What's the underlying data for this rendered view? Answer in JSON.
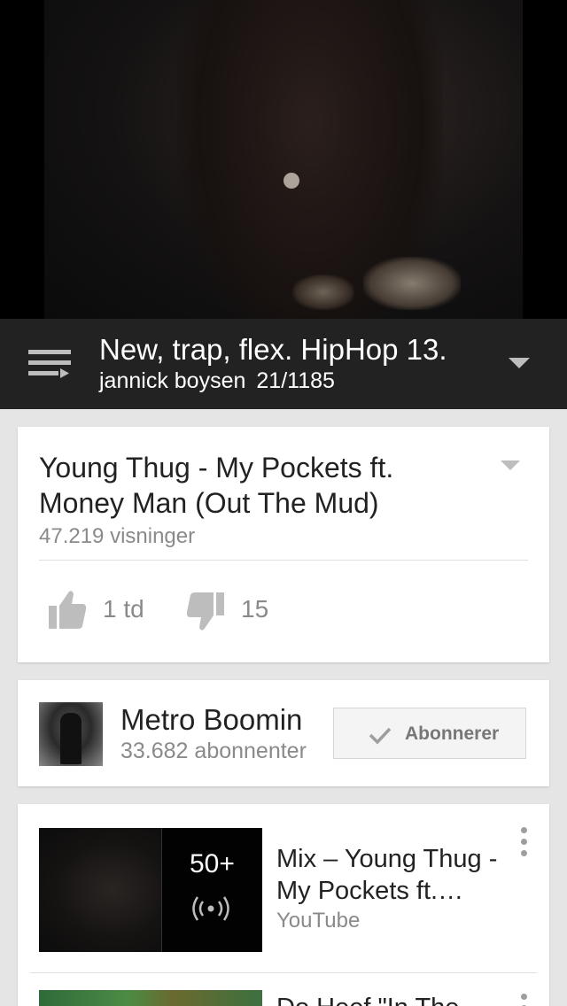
{
  "playlist": {
    "title": "New, trap, flex. HipHop 13.",
    "owner": "jannick boysen",
    "position": "21/1185"
  },
  "video": {
    "title": "Young Thug - My Pockets ft. Money Man (Out The Mud)",
    "views": "47.219 visninger",
    "likes": "1 td",
    "dislikes": "15"
  },
  "channel": {
    "name": "Metro Boomin",
    "subscribers": "33.682 abonnenter",
    "subscribe_label": "Abonnerer"
  },
  "up_next": [
    {
      "title": "Mix – Young Thug - My Pockets ft.…",
      "source": "YouTube",
      "count": "50+"
    },
    {
      "title": "Do Heef \"In The"
    }
  ],
  "colors": {
    "playlist_bar": "#222222",
    "background": "#e5e5e5",
    "secondary_text": "#8a8a8a"
  },
  "icons": [
    "playlist-icon",
    "caret-down-icon",
    "thumbs-up-icon",
    "thumbs-down-icon",
    "check-icon",
    "mix-radio-icon",
    "more-vert-icon"
  ]
}
